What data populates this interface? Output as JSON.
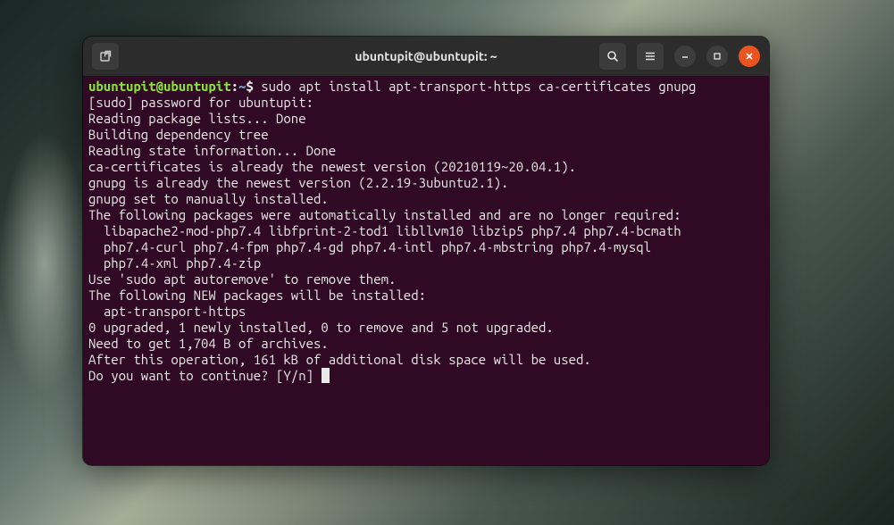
{
  "titlebar": {
    "title": "ubuntupit@ubuntupit: ~"
  },
  "prompt": {
    "user_host": "ubuntupit@ubuntupit",
    "path": "~",
    "symbol": "$",
    "command": "sudo apt install apt-transport-https ca-certificates gnupg"
  },
  "lines": [
    "[sudo] password for ubuntupit: ",
    "Reading package lists... Done",
    "Building dependency tree       ",
    "Reading state information... Done",
    "ca-certificates is already the newest version (20210119~20.04.1).",
    "gnupg is already the newest version (2.2.19-3ubuntu2.1).",
    "gnupg set to manually installed.",
    "The following packages were automatically installed and are no longer required:",
    "  libapache2-mod-php7.4 libfprint-2-tod1 libllvm10 libzip5 php7.4 php7.4-bcmath",
    "  php7.4-curl php7.4-fpm php7.4-gd php7.4-intl php7.4-mbstring php7.4-mysql",
    "  php7.4-xml php7.4-zip",
    "Use 'sudo apt autoremove' to remove them.",
    "The following NEW packages will be installed:",
    "  apt-transport-https",
    "0 upgraded, 1 newly installed, 0 to remove and 5 not upgraded.",
    "Need to get 1,704 B of archives.",
    "After this operation, 161 kB of additional disk space will be used.",
    "Do you want to continue? [Y/n] "
  ]
}
